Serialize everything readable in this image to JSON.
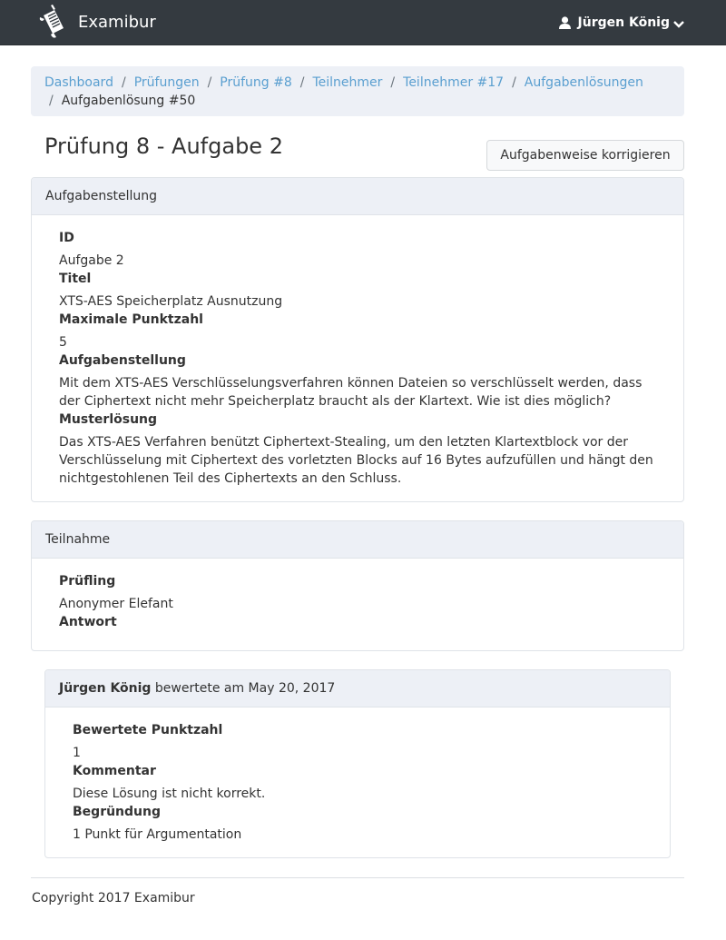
{
  "navbar": {
    "brand": "Examibur",
    "user_name": "Jürgen König"
  },
  "breadcrumb": {
    "items": [
      {
        "label": "Dashboard"
      },
      {
        "label": "Prüfungen"
      },
      {
        "label": "Prüfung #8"
      },
      {
        "label": "Teilnehmer"
      },
      {
        "label": "Teilnehmer #17"
      },
      {
        "label": "Aufgabenlösungen"
      }
    ],
    "active": "Aufgabenlösung #50"
  },
  "page": {
    "title": "Prüfung 8 - Aufgabe 2",
    "correct_button": "Aufgabenweise korrigieren"
  },
  "task_card": {
    "header": "Aufgabenstellung",
    "fields": [
      {
        "label": "ID",
        "value": "Aufgabe 2"
      },
      {
        "label": "Titel",
        "value": "XTS-AES Speicherplatz Ausnutzung"
      },
      {
        "label": "Maximale Punktzahl",
        "value": "5"
      },
      {
        "label": "Aufgabenstellung",
        "value": "Mit dem XTS-AES Verschlüsselungsverfahren können Dateien so verschlüsselt werden, dass der Ciphertext nicht mehr Speicherplatz braucht als der Klartext. Wie ist dies möglich?"
      },
      {
        "label": "Musterlösung",
        "value": "Das XTS-AES Verfahren benützt Ciphertext-Stealing, um den letzten Klartextblock vor der Verschlüsselung mit Ciphertext des vorletzten Blocks auf 16 Bytes aufzufüllen und hängt den nichtgestohlenen Teil des Ciphertexts an den Schluss."
      }
    ]
  },
  "participation_card": {
    "header": "Teilnahme",
    "examinee_label": "Prüfling",
    "examinee_value": "Anonymer Elefant",
    "answer_label": "Antwort"
  },
  "rating_card": {
    "rater": "Jürgen König",
    "rated_text": "bewertete am May 20, 2017",
    "fields": [
      {
        "label": "Bewertete Punktzahl",
        "value": "1"
      },
      {
        "label": "Kommentar",
        "value": "Diese Lösung ist nicht korrekt."
      },
      {
        "label": "Begründung",
        "value": "1 Punkt für Argumentation"
      }
    ]
  },
  "footer": {
    "copyright": "Copyright 2017 Examibur"
  },
  "colors": {
    "navbar_bg": "#343a40",
    "link": "#5a9fd0",
    "card_header_bg": "#edf0f6"
  },
  "icons": {
    "brand": "scroll-quill-icon",
    "user": "user-icon",
    "dropdown": "chevron-down-icon"
  }
}
